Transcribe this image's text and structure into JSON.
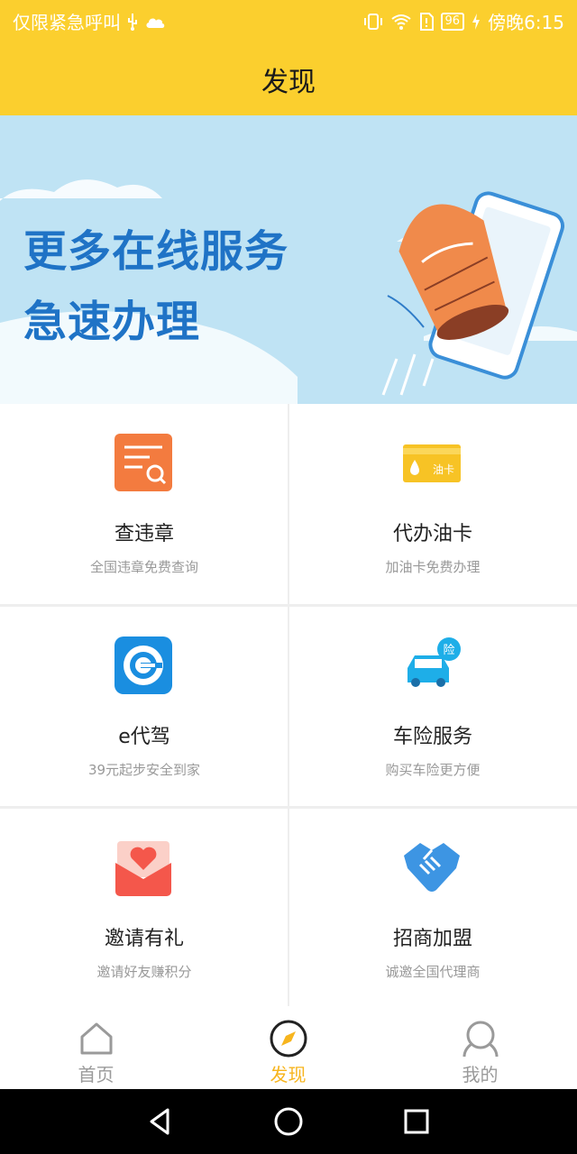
{
  "status_bar": {
    "left_text": "仅限紧急呼叫",
    "battery": "96",
    "time": "傍晚6:15"
  },
  "header": {
    "title": "发现"
  },
  "banner": {
    "line1": "更多在线服务",
    "line2": "急速办理"
  },
  "services": [
    {
      "title": "查违章",
      "subtitle": "全国违章免费查询",
      "icon": "violation-search-icon"
    },
    {
      "title": "代办油卡",
      "subtitle": "加油卡免费办理",
      "icon": "fuel-card-icon",
      "icon_label": "油卡"
    },
    {
      "title": "e代驾",
      "subtitle": "39元起步安全到家",
      "icon": "e-driver-icon"
    },
    {
      "title": "车险服务",
      "subtitle": "购买车险更方便",
      "icon": "car-insurance-icon",
      "icon_label": "险"
    },
    {
      "title": "邀请有礼",
      "subtitle": "邀请好友赚积分",
      "icon": "invite-envelope-icon"
    },
    {
      "title": "招商加盟",
      "subtitle": "诚邀全国代理商",
      "icon": "handshake-icon"
    }
  ],
  "tabbar": {
    "tabs": [
      {
        "label": "首页",
        "icon": "home-icon",
        "active": false
      },
      {
        "label": "发现",
        "icon": "compass-icon",
        "active": true
      },
      {
        "label": "我的",
        "icon": "profile-icon",
        "active": false
      }
    ]
  },
  "colors": {
    "header_bg": "#fbcf2e",
    "active_tab": "#f7b51e",
    "banner_text": "#1f73c6"
  }
}
